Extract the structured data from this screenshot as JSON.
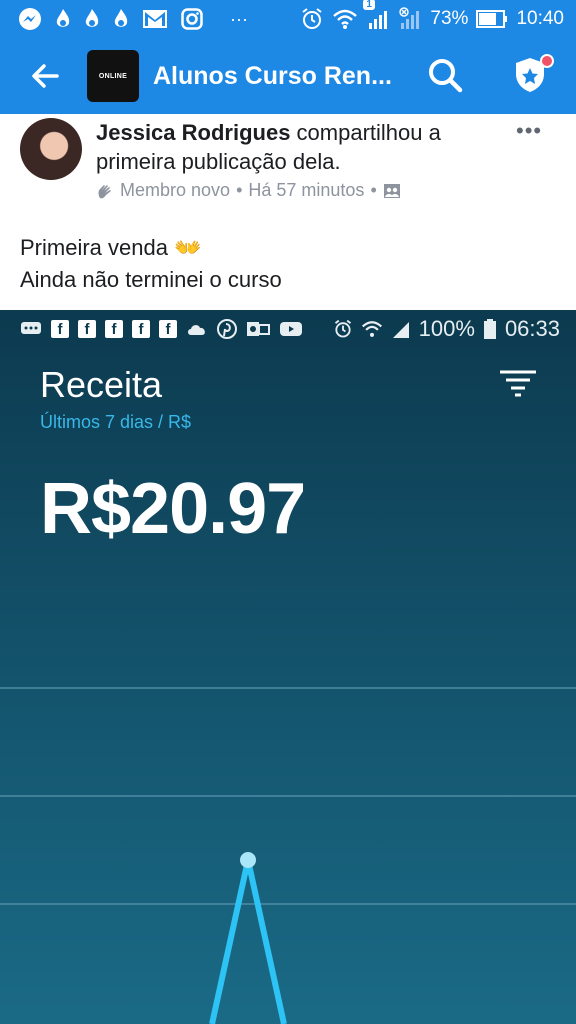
{
  "status_bar": {
    "battery": "73%",
    "time": "10:40",
    "notif_badge": "1"
  },
  "app_bar": {
    "group_thumb": "ONLINE",
    "title": "Alunos Curso Ren..."
  },
  "post": {
    "author": "Jessica Rodrigues",
    "action": " compartilhou a primeira publicação dela.",
    "badge": "Membro novo",
    "separator": "•",
    "time": "Há 57 minutos",
    "text_line1": "Primeira venda 👐",
    "text_line2": "Ainda não terminei o curso"
  },
  "screenshot": {
    "status": {
      "battery": "100%",
      "time": "06:33"
    },
    "title": "Receita",
    "subtitle": "Últimos 7 dias / R$",
    "amount": "R$20.97",
    "accent": "#39b7e8"
  },
  "chart_data": {
    "type": "line",
    "title": "Receita",
    "subtitle": "Últimos 7 dias / R$",
    "xlabel": "",
    "ylabel": "",
    "grid": true,
    "visible_peak_only": true
  }
}
